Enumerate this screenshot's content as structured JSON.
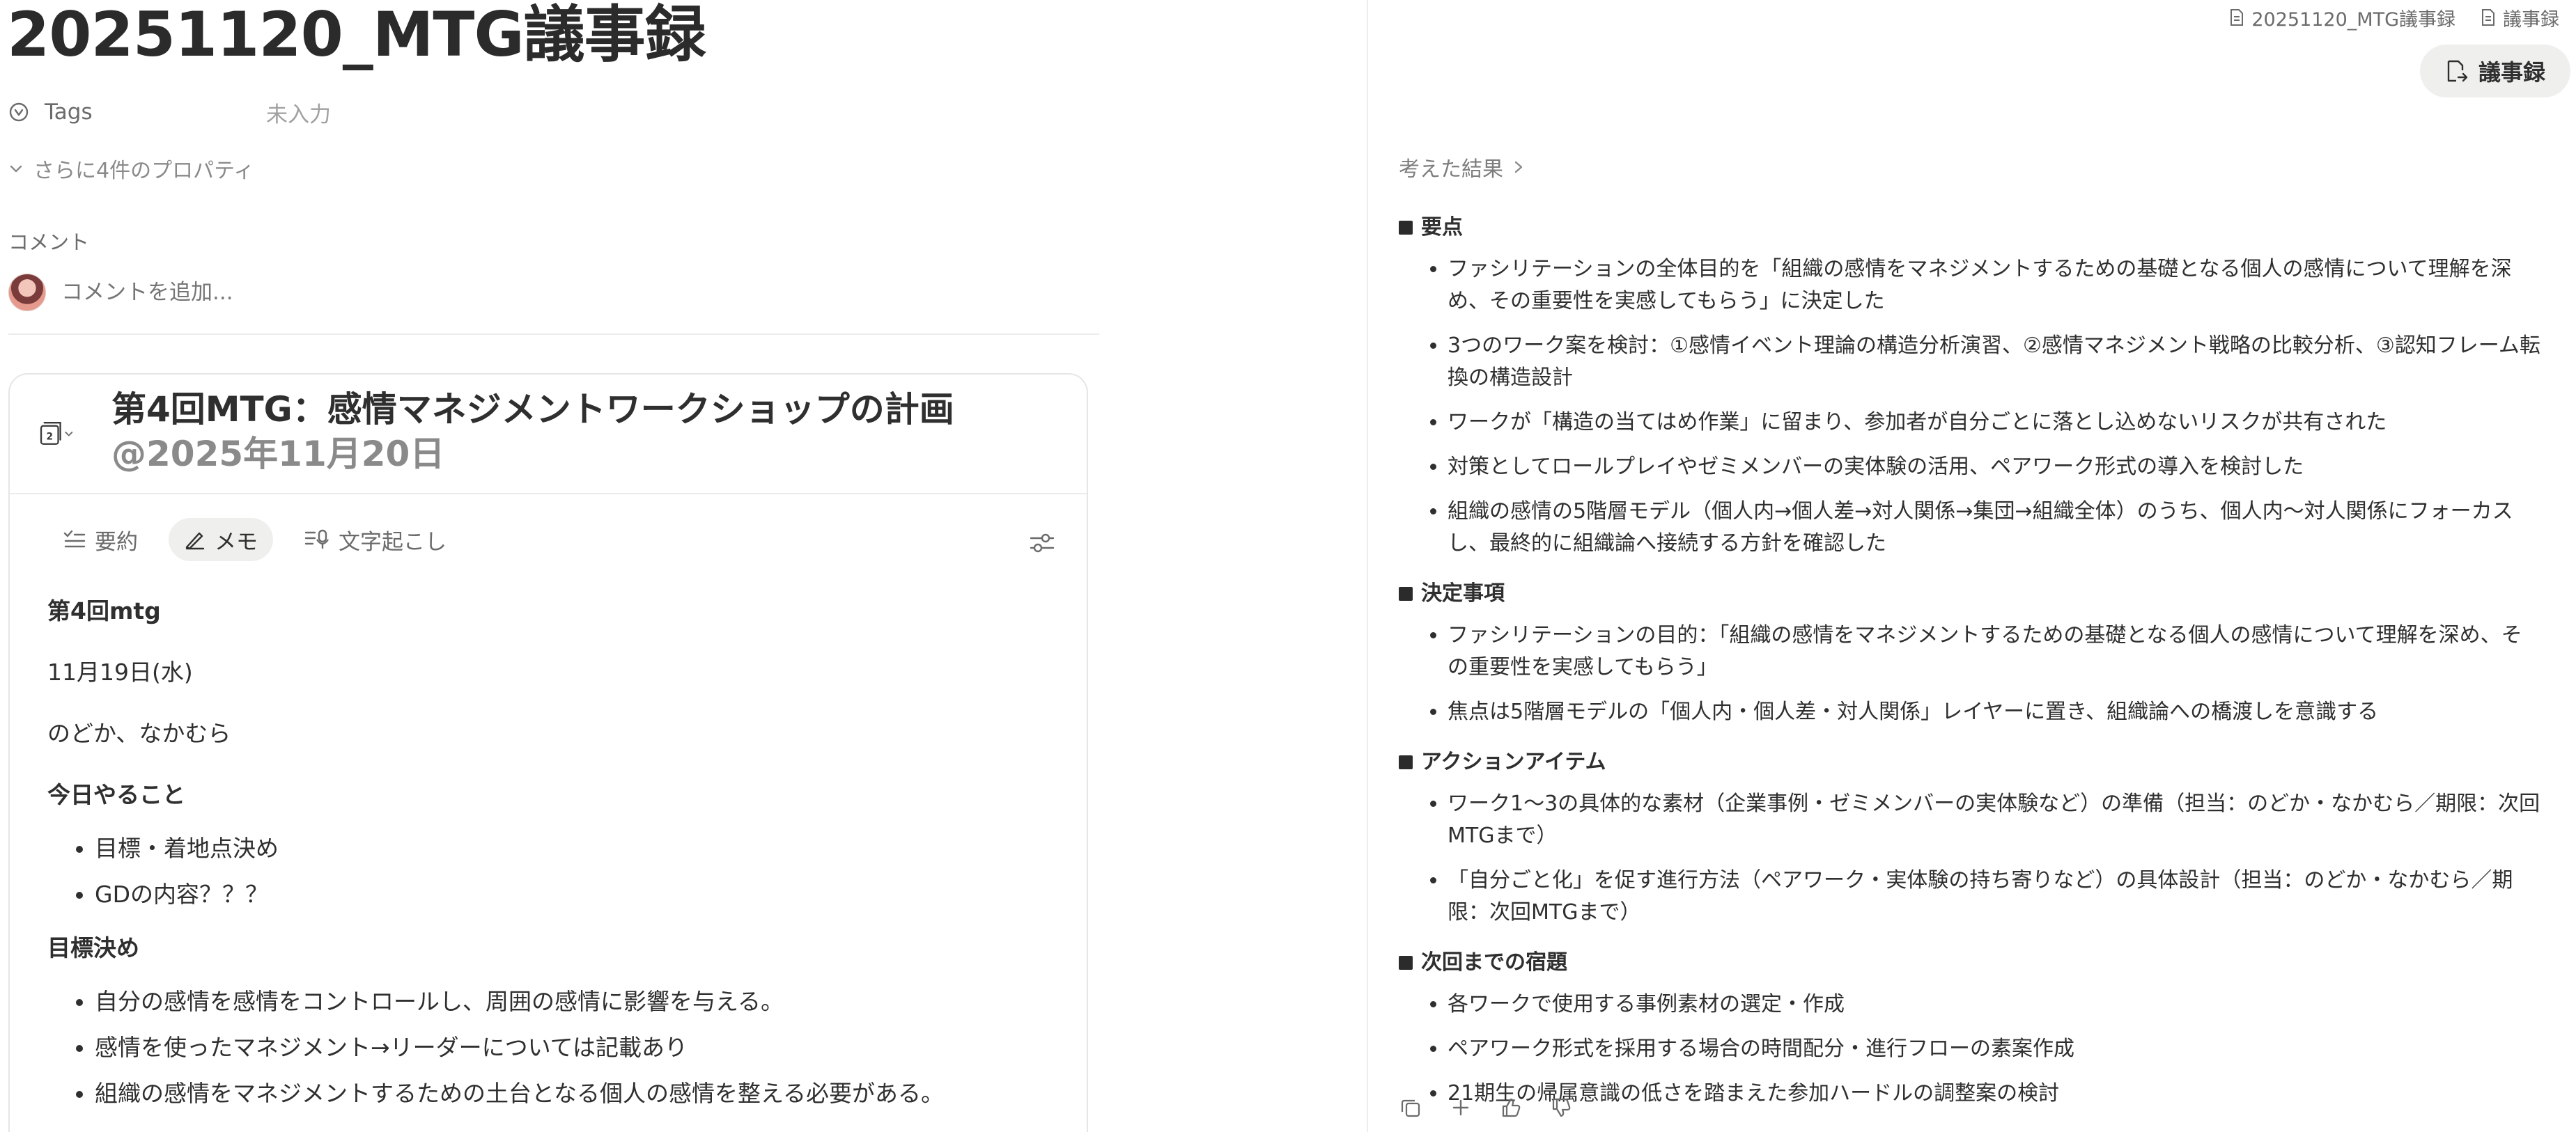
{
  "page": {
    "title": "20251120_MTG議事録"
  },
  "properties": {
    "tags_label": "Tags",
    "tags_value": "未入力",
    "more_label": "さらに4件のプロパティ"
  },
  "comments": {
    "label": "コメント",
    "placeholder": "コメントを追加..."
  },
  "card": {
    "title": "第4回MTG：感情マネジメントワークショップの計画 ",
    "mention": "@2025年11月20日",
    "icon_badge": "2",
    "tabs": {
      "summary": "要約",
      "memo": "メモ",
      "transcript": "文字起こし"
    },
    "memo": {
      "heading1": "第4回mtg",
      "date": "11月19日(水)",
      "members": "のどか、なかむら",
      "heading2": "今日やること",
      "todo": [
        "目標・着地点決め",
        "GDの内容？？？"
      ],
      "heading3": "目標決め",
      "goals": [
        "自分の感情を感情をコントロールし、周囲の感情に影響を与える。",
        "感情を使ったマネジメント→リーダーについては記載あり",
        "組織の感情をマネジメントするための土台となる個人の感情を整える必要がある。"
      ]
    }
  },
  "right_panel": {
    "breadcrumb": [
      "20251120_MTG議事録",
      "議事録"
    ],
    "insert_button": "議事録",
    "thought_label": "考えた結果",
    "sections": [
      {
        "heading": "要点",
        "items": [
          "ファシリテーションの全体目的を「組織の感情をマネジメントするための基礎となる個人の感情について理解を深め、その重要性を実感してもらう」に決定した",
          "3つのワーク案を検討：①感情イベント理論の構造分析演習、②感情マネジメント戦略の比較分析、③認知フレーム転換の構造設計",
          "ワークが「構造の当てはめ作業」に留まり、参加者が自分ごとに落とし込めないリスクが共有された",
          "対策としてロールプレイやゼミメンバーの実体験の活用、ペアワーク形式の導入を検討した",
          "組織の感情の5階層モデル（個人内→個人差→対人関係→集団→組織全体）のうち、個人内〜対人関係にフォーカスし、最終的に組織論へ接続する方針を確認した"
        ]
      },
      {
        "heading": "決定事項",
        "items": [
          "ファシリテーションの目的：「組織の感情をマネジメントするための基礎となる個人の感情について理解を深め、その重要性を実感してもらう」",
          "焦点は5階層モデルの「個人内・個人差・対人関係」レイヤーに置き、組織論への橋渡しを意識する"
        ]
      },
      {
        "heading": "アクションアイテム",
        "items": [
          "ワーク1〜3の具体的な素材（企業事例・ゼミメンバーの実体験など）の準備（担当：のどか・なかむら／期限：次回MTGまで）",
          "「自分ごと化」を促す進行方法（ペアワーク・実体験の持ち寄りなど）の具体設計（担当：のどか・なかむら／期限：次回MTGまで）"
        ]
      },
      {
        "heading": "次回までの宿題",
        "items": [
          "各ワークで使用する事例素材の選定・作成",
          "ペアワーク形式を採用する場合の時間配分・進行フローの素案作成",
          "21期生の帰属意識の低さを踏まえた参加ハードルの調整案の検討"
        ]
      }
    ]
  },
  "colors": {
    "text": "#2f2f2f",
    "muted": "#6b6b6b",
    "placeholder": "#a9a9a9",
    "pill_bg": "#efefed",
    "border": "#e6e6e6"
  }
}
